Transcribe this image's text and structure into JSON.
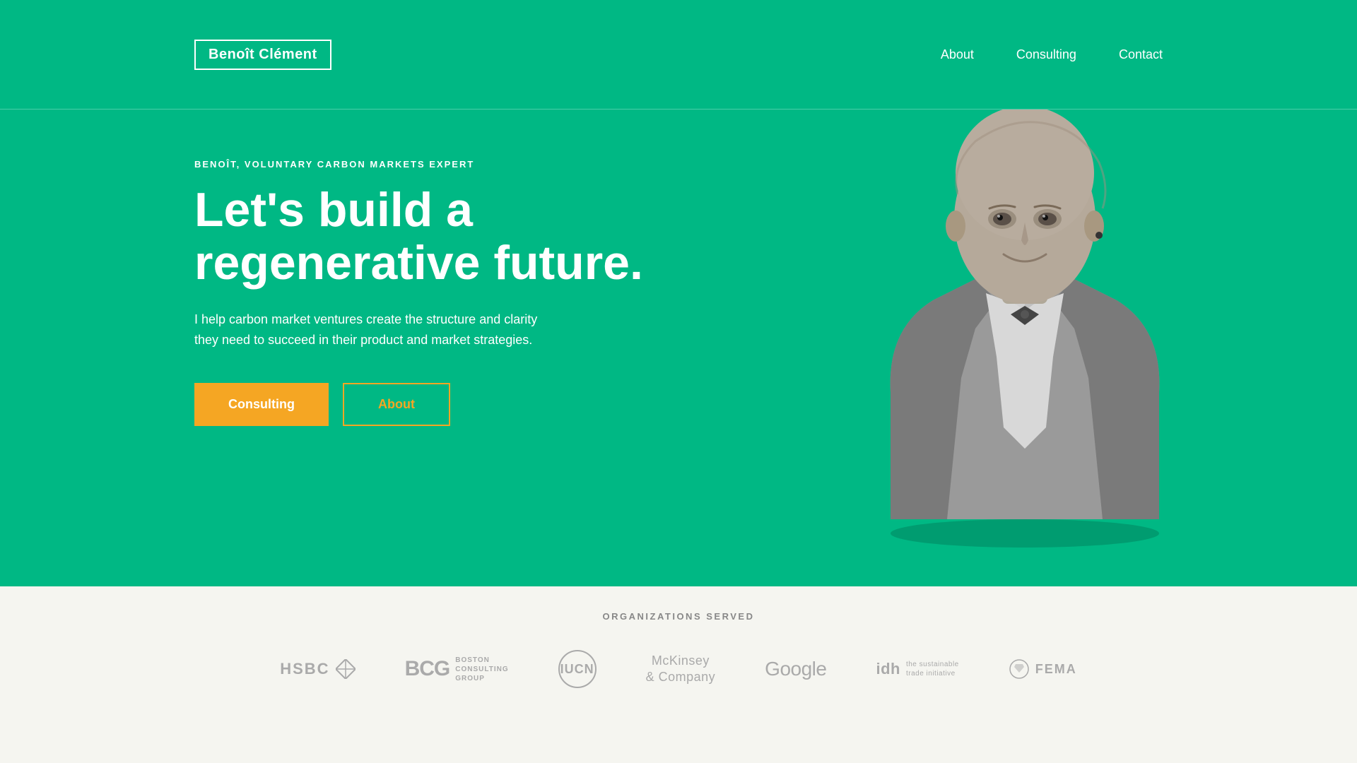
{
  "logo": {
    "first_name": "Benoît",
    "last_name": "Clément"
  },
  "nav": {
    "items": [
      {
        "label": "About",
        "href": "#about"
      },
      {
        "label": "Consulting",
        "href": "#consulting"
      },
      {
        "label": "Contact",
        "href": "#contact"
      }
    ]
  },
  "hero": {
    "subtitle": "BENOÎT, VOLUNTARY CARBON MARKETS EXPERT",
    "title_line1": "Let's build a",
    "title_line2": "regenerative future.",
    "description": "I help carbon market ventures create the structure and clarity they need to succeed in their product and market strategies.",
    "btn_consulting": "Consulting",
    "btn_about": "About"
  },
  "orgs": {
    "label": "ORGANIZATIONS SERVED",
    "logos": [
      {
        "name": "HSBC"
      },
      {
        "name": "BCG Boston Consulting Group"
      },
      {
        "name": "IUCN"
      },
      {
        "name": "McKinsey & Company"
      },
      {
        "name": "Google"
      },
      {
        "name": "IDH The Sustainable Trade Initiative"
      },
      {
        "name": "FEMA"
      }
    ]
  },
  "colors": {
    "primary_bg": "#00b884",
    "accent": "#f5a623",
    "white": "#ffffff",
    "bottom_bg": "#f5f5f0"
  }
}
